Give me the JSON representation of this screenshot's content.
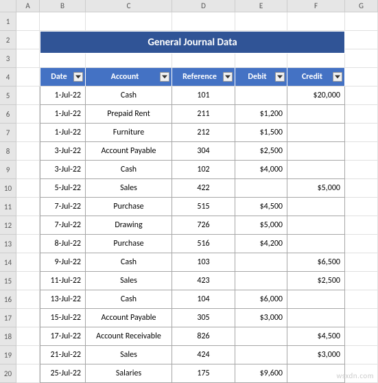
{
  "columns": [
    "A",
    "B",
    "C",
    "D",
    "E",
    "F",
    "G"
  ],
  "rowStart": 1,
  "rowEnd": 20,
  "title": "General Journal Data",
  "headers": {
    "date": "Date",
    "account": "Account",
    "reference": "Reference",
    "debit": "Debit",
    "credit": "Credit"
  },
  "rows": [
    {
      "date": "1-Jul-22",
      "account": "Cash",
      "ref": "101",
      "debit": "",
      "credit": "$20,000"
    },
    {
      "date": "1-Jul-22",
      "account": "Prepaid Rent",
      "ref": "211",
      "debit": "$1,200",
      "credit": ""
    },
    {
      "date": "1-Jul-22",
      "account": "Furniture",
      "ref": "212",
      "debit": "$1,500",
      "credit": ""
    },
    {
      "date": "3-Jul-22",
      "account": "Account Payable",
      "ref": "304",
      "debit": "$2,500",
      "credit": ""
    },
    {
      "date": "3-Jul-22",
      "account": "Cash",
      "ref": "102",
      "debit": "$4,000",
      "credit": ""
    },
    {
      "date": "5-Jul-22",
      "account": "Sales",
      "ref": "422",
      "debit": "",
      "credit": "$5,000"
    },
    {
      "date": "7-Jul-22",
      "account": "Purchase",
      "ref": "515",
      "debit": "$4,500",
      "credit": ""
    },
    {
      "date": "7-Jul-22",
      "account": "Drawing",
      "ref": "726",
      "debit": "$5,000",
      "credit": ""
    },
    {
      "date": "8-Jul-22",
      "account": "Purchase",
      "ref": "516",
      "debit": "$4,200",
      "credit": ""
    },
    {
      "date": "9-Jul-22",
      "account": "Cash",
      "ref": "103",
      "debit": "",
      "credit": "$6,500"
    },
    {
      "date": "11-Jul-22",
      "account": "Sales",
      "ref": "423",
      "debit": "",
      "credit": "$2,500"
    },
    {
      "date": "13-Jul-22",
      "account": "Cash",
      "ref": "104",
      "debit": "$6,000",
      "credit": ""
    },
    {
      "date": "15-Jul-22",
      "account": "Account Payable",
      "ref": "305",
      "debit": "$3,000",
      "credit": ""
    },
    {
      "date": "17-Jul-22",
      "account": "Account Receivable",
      "ref": "826",
      "debit": "",
      "credit": "$4,500"
    },
    {
      "date": "21-Jul-22",
      "account": "Sales",
      "ref": "424",
      "debit": "",
      "credit": "$3,000"
    },
    {
      "date": "25-Jul-22",
      "account": "Salaries",
      "ref": "175",
      "debit": "$9,600",
      "credit": ""
    }
  ],
  "watermark": "wsxdn.com"
}
